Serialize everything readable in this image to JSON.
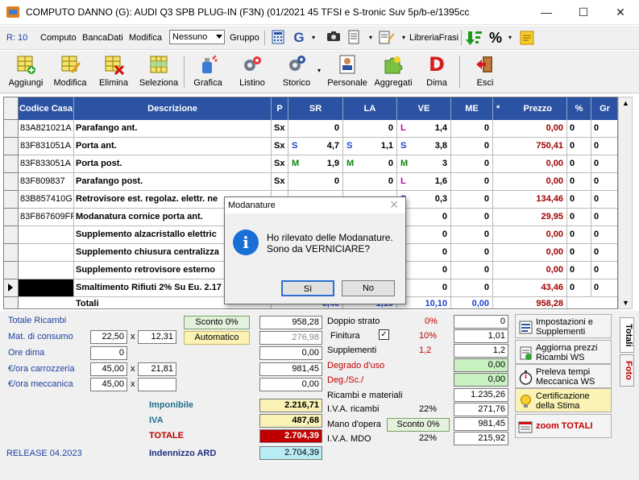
{
  "window": {
    "title": "COMPUTO DANNO (G):  AUDI Q3 SPB PLUG-IN (F3N) (01/2021 45 TFSI e S-tronic Suv 5p/b-e/1395cc",
    "minimize": "—",
    "maximize": "☐",
    "close": "✕"
  },
  "menu": {
    "r": "R: 10",
    "computo": "Computo",
    "bancadati": "BancaDati",
    "modifica": "Modifica",
    "combo_value": "Nessuno",
    "gruppo": "Gruppo",
    "g": "G",
    "librerie": "LibreriaFrasi",
    "percent": "%"
  },
  "toolbar": {
    "aggiungi": "Aggiungi",
    "modifica": "Modifica",
    "elimina": "Elimina",
    "seleziona": "Seleziona",
    "grafica": "Grafica",
    "listino": "Listino",
    "storico": "Storico",
    "personale": "Personale",
    "aggregati": "Aggregati",
    "dima": "Dima",
    "dima_letter": "D",
    "esci": "Esci"
  },
  "grid": {
    "headers": {
      "codice": "Codice Casa",
      "descrizione": "Descrizione",
      "p": "P",
      "sr": "SR",
      "la": "LA",
      "ve": "VE",
      "me": "ME",
      "star": "*",
      "prezzo": "Prezzo",
      "pct": "%",
      "gr": "Gr"
    },
    "rows": [
      {
        "code": "83A821021A",
        "desc": "Parafango ant.",
        "p": "Sx",
        "sr_f": "",
        "sr": "0",
        "la_f": "",
        "la": "0",
        "ve_f": "L",
        "ve": "1,4",
        "me": "0",
        "prezzo": "0,00",
        "pct": "0",
        "gr": "0"
      },
      {
        "code": "83F831051A",
        "desc": "Porta ant.",
        "p": "Sx",
        "sr_f": "S",
        "sr": "4,7",
        "la_f": "S",
        "la": "1,1",
        "ve_f": "S",
        "ve": "3,8",
        "me": "0",
        "prezzo": "750,41",
        "pct": "0",
        "gr": "0"
      },
      {
        "code": "83F833051A",
        "desc": "Porta post.",
        "p": "Sx",
        "sr_f": "M",
        "sr": "1,9",
        "la_f": "M",
        "la": "0",
        "ve_f": "M",
        "ve": "3",
        "me": "0",
        "prezzo": "0,00",
        "pct": "0",
        "gr": "0"
      },
      {
        "code": "83F809837",
        "desc": "Parafango post.",
        "p": "Sx",
        "sr_f": "",
        "sr": "0",
        "la_f": "",
        "la": "0",
        "ve_f": "L",
        "ve": "1,6",
        "me": "0",
        "prezzo": "0,00",
        "pct": "0",
        "gr": "0"
      },
      {
        "code": "83B857410G",
        "desc": "Retrovisore est. regolaz. elettr. ne",
        "p": "",
        "sr_f": "",
        "sr": "",
        "la_f": "",
        "la": "",
        "ve_f": "S",
        "ve": "0,3",
        "me": "0",
        "prezzo": "134,46",
        "pct": "0",
        "gr": "0"
      },
      {
        "code": "83F867609FR",
        "desc": "Modanatura cornice porta ant.",
        "p": "",
        "sr_f": "",
        "sr": "",
        "la_f": "",
        "la": "",
        "ve_f": "S",
        "ve": "0",
        "me": "0",
        "prezzo": "29,95",
        "pct": "0",
        "gr": "0"
      },
      {
        "code": "",
        "desc": "Supplemento alzacristallo elettric",
        "p": "",
        "sr_f": "",
        "sr": "",
        "la_f": "",
        "la": "",
        "ve_f": "",
        "ve": "0",
        "me": "0",
        "prezzo": "0,00",
        "pct": "0",
        "gr": "0"
      },
      {
        "code": "",
        "desc": "Supplemento chiusura centralizza",
        "p": "",
        "sr_f": "",
        "sr": "",
        "la_f": "",
        "la": "",
        "ve_f": "",
        "ve": "0",
        "me": "0",
        "prezzo": "0,00",
        "pct": "0",
        "gr": "0"
      },
      {
        "code": "",
        "desc": "Supplemento retrovisore esterno",
        "p": "",
        "sr_f": "",
        "sr": "",
        "la_f": "",
        "la": "",
        "ve_f": "",
        "ve": "0",
        "me": "0",
        "prezzo": "0,00",
        "pct": "0",
        "gr": "0"
      },
      {
        "code": "",
        "desc": "Smaltimento Rifiuti 2% Su Eu. 2.17",
        "p": "",
        "sr_f": "",
        "sr": "",
        "la_f": "",
        "la": "",
        "ve_f": "",
        "ve": "0",
        "me": "0",
        "prezzo": "43,46",
        "pct": "0",
        "gr": "0"
      }
    ],
    "totals": {
      "label": "Totali",
      "sr": "6,40",
      "la": "1,10",
      "ve": "10,10",
      "me": "0,00",
      "prezzo": "958,28"
    }
  },
  "bottom": {
    "totale_ricambi": "Totale Ricambi",
    "sconto_btn": "Sconto 0%",
    "totale_ricambi_val": "958,28",
    "mat_consumo": "Mat. di consumo",
    "mat_a": "22,50",
    "mat_x": "x",
    "mat_b": "12,31",
    "automatico": "Automatico",
    "mat_val": "276,98",
    "ore_dima": "Ore dima",
    "ore_dima_val": "0",
    "ore_dima_tot": "0,00",
    "ora_carrozzeria": "€/ora carrozzeria",
    "carr_a": "45,00",
    "carr_x": "x",
    "carr_b": "21,81",
    "carr_tot": "981,45",
    "ora_meccanica": "€/ora meccanica",
    "mecc_a": "45,00",
    "mecc_x": "x",
    "mecc_b": "",
    "mecc_tot": "0,00",
    "imponibile": "Imponibile",
    "imponibile_val": "2.216,71",
    "iva": "IVA",
    "iva_val": "487,68",
    "totale": "TOTALE",
    "totale_val": "2.704,39",
    "release": "RELEASE 04.2023",
    "indennizzo": "Indennizzo ARD",
    "indennizzo_val": "2.704,39",
    "doppio_strato": "Doppio strato",
    "doppio_pct": "0%",
    "doppio_val": "0",
    "finitura": "Finitura",
    "finitura_check": "✓",
    "finitura_pct": "10%",
    "finitura_val": "1,01",
    "supplementi": "Supplementi",
    "supplementi_pct": "1,2",
    "supplementi_val": "1,2",
    "degrado": "Degrado d'uso",
    "degrado_val": "0,00",
    "deg_sc": "Deg./Sc./",
    "deg_sc_val": "0,00",
    "ricambi_materiali": "Ricambi e materiali",
    "ricambi_materiali_val": "1.235,26",
    "iva_ricambi": "I.V.A. ricambi",
    "iva_ricambi_pct": "22%",
    "iva_ricambi_val": "271,76",
    "mano_opera": "Mano d'opera",
    "sconto_mano": "Sconto 0%",
    "mano_opera_val": "981,45",
    "iva_mdo": "I.V.A. MDO",
    "iva_mdo_pct": "22%",
    "iva_mdo_val": "215,92",
    "side_impostazioni": "Impostazioni e Supplementi",
    "side_aggiorna": "Aggiorna prezzi Ricambi WS",
    "side_preleva": "Preleva tempi Meccanica WS",
    "side_certificazione": "Certificazione della Stima",
    "side_zoom": "zoom TOTALI",
    "tab_totali": "Totali",
    "tab_foto": "Foto"
  },
  "dialog": {
    "title": "Modanature",
    "close": "✕",
    "line1": "Ho rilevato delle Modanature.",
    "line2": "Sono da VERNICIARE?",
    "yes": "Sì",
    "no": "No"
  },
  "colors": {
    "header_blue": "#2c53a3",
    "price_red": "#a00000",
    "total_red": "#c00000",
    "flag_s": "#1f3fcf",
    "flag_m": "#0a8a0a",
    "flag_l": "#c000c0"
  }
}
